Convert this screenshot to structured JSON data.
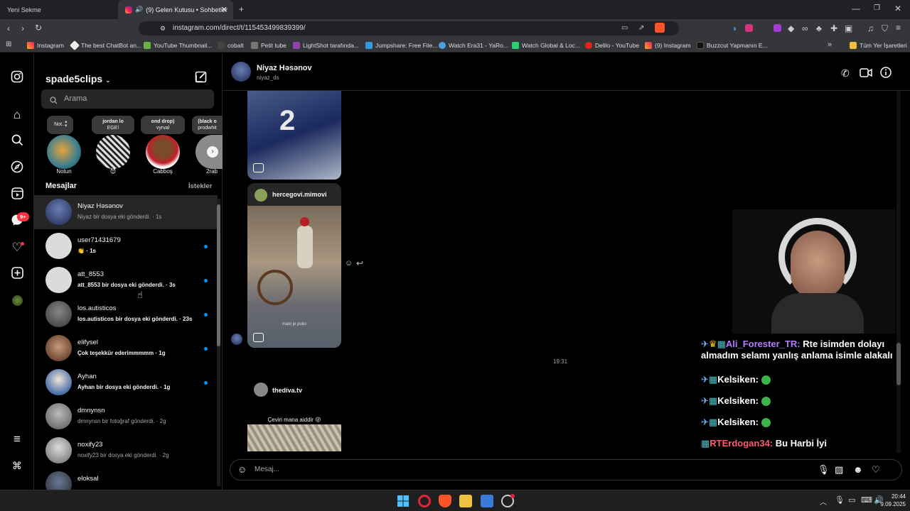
{
  "browser": {
    "tabs": [
      {
        "label": "Yeni Sekme"
      },
      {
        "label": "(9) Gelen Kutusu • Sohbetler"
      }
    ],
    "url": "instagram.com/direct/t/115453499839399/",
    "bookmarks": [
      "Instagram",
      "The best ChatBot an...",
      "YouTube Thumbnail...",
      "cobalt",
      "Petit tube",
      "LightShot tarafında...",
      "Jumpshare: Free File...",
      "Watch Era31 - YaRo...",
      "Watch Global & Loc...",
      "Delilo - YouTube",
      "(9) Instagram",
      "Buzzcut Yapmanın E..."
    ],
    "all_bookmarks": "Tüm Yer İşaretleri"
  },
  "nav": {
    "notification_badge": "9+"
  },
  "sidebar": {
    "username": "spade5clips",
    "search_placeholder": "Arama",
    "notes": [
      {
        "text": "Not..."
      },
      {
        "text": "jordan lo",
        "sub": "EGE!"
      },
      {
        "text": "ond drop)",
        "sub": "vyrval"
      },
      {
        "text": "(black o",
        "sub": "prodwhit"
      }
    ],
    "stories": [
      {
        "label": "Notun"
      },
      {
        "label": "😈"
      },
      {
        "label": "Cabboş"
      },
      {
        "label": "2rab"
      }
    ],
    "messages_title": "Mesajlar",
    "requests_label": "İstekler",
    "conversations": [
      {
        "name": "Niyaz Həsənov",
        "preview": "Niyaz bir dosya eki gönderdi.",
        "time": "1s",
        "unread": false
      },
      {
        "name": "user71431679",
        "preview": "👏",
        "time": "1s",
        "unread": true
      },
      {
        "name": "att_8553",
        "preview": "att_8553 bir dosya eki gönderdi.",
        "time": "3s",
        "unread": true
      },
      {
        "name": "los.autisticos",
        "preview": "los.autisticos bir dosya eki gönderdi.",
        "time": "23s",
        "unread": true
      },
      {
        "name": "elifysel",
        "preview": "Çok teşekkür ederimmmmm",
        "time": "1g",
        "unread": true
      },
      {
        "name": "Ayhan",
        "preview": "Ayhan bir dosya eki gönderdi.",
        "time": "1g",
        "unread": true
      },
      {
        "name": "dmnynsn",
        "preview": "dmnynsn bir fotoğraf gönderdi.",
        "time": "2g",
        "unread": false
      },
      {
        "name": "noxify23",
        "preview": "noxify23 bir dosya eki gönderdi.",
        "time": "2g",
        "unread": false
      },
      {
        "name": "eloksal",
        "preview": "",
        "time": "",
        "unread": false
      }
    ]
  },
  "chat": {
    "name": "Niyaz Həsənov",
    "handle": "niyaz_ds",
    "reel1_author": "hercegovi.mimovi",
    "reel1_caption": "malo je puko",
    "timestamp": "19:31",
    "reel2_author": "thediva.tv",
    "reel2_caption": "Çeviri mana aiddir 😜",
    "composer_placeholder": "Mesaj..."
  },
  "stream_chat": [
    {
      "user": "Ali_Forester_TR:",
      "text": "Rte isimden dolayı",
      "text2": "almadım selamı yanlış anlama isimle alakalı",
      "color": "#b57bff"
    },
    {
      "user": "Kelsiken:",
      "text": "",
      "color": "#ffffff"
    },
    {
      "user": "Kelsiken:",
      "text": "",
      "color": "#ffffff"
    },
    {
      "user": "Kelsiken:",
      "text": "",
      "color": "#ffffff"
    },
    {
      "user": "RTErdogan34:",
      "text": "Bu Harbi İyi",
      "color": "#ff5a6e"
    }
  ],
  "taskbar": {
    "time": "20:44",
    "date": "9.09.2025"
  }
}
